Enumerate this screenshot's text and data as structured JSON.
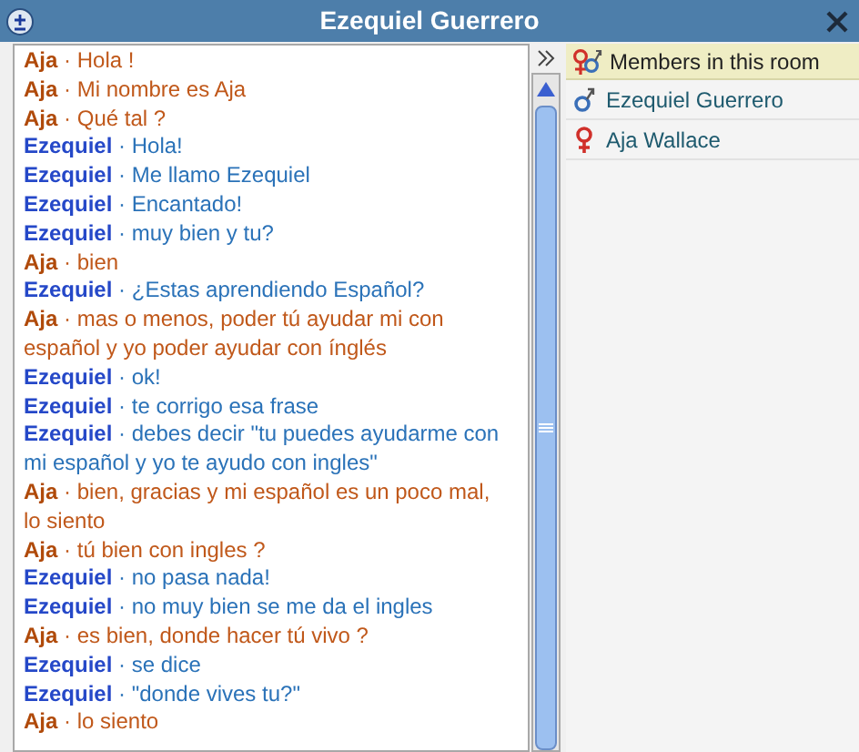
{
  "window": {
    "title": "Ezequiel Guerrero"
  },
  "messages": [
    {
      "sender": "Aja",
      "kind": "aja",
      "separator": "·",
      "text": "Hola !"
    },
    {
      "sender": "Aja",
      "kind": "aja",
      "separator": "·",
      "text": "Mi nombre es Aja"
    },
    {
      "sender": "Aja",
      "kind": "aja",
      "separator": "·",
      "text": "Qué tal ?"
    },
    {
      "sender": "Ezequiel",
      "kind": "ezequiel",
      "separator": "·",
      "text": "Hola!"
    },
    {
      "sender": "Ezequiel",
      "kind": "ezequiel",
      "separator": "·",
      "text": "Me llamo Ezequiel"
    },
    {
      "sender": "Ezequiel",
      "kind": "ezequiel",
      "separator": "·",
      "text": "Encantado!"
    },
    {
      "sender": "Ezequiel",
      "kind": "ezequiel",
      "separator": "·",
      "text": "muy bien y tu?"
    },
    {
      "sender": "Aja",
      "kind": "aja",
      "separator": "·",
      "text": "bien"
    },
    {
      "sender": "Ezequiel",
      "kind": "ezequiel",
      "separator": "·",
      "text": "¿Estas aprendiendo Español?"
    },
    {
      "sender": "Aja",
      "kind": "aja",
      "separator": "·",
      "text": "mas o menos, poder tú ayudar mi con español y yo poder ayudar con ínglés"
    },
    {
      "sender": "Ezequiel",
      "kind": "ezequiel",
      "separator": "·",
      "text": "ok!"
    },
    {
      "sender": "Ezequiel",
      "kind": "ezequiel",
      "separator": "·",
      "text": "te corrigo esa frase"
    },
    {
      "sender": "Ezequiel",
      "kind": "ezequiel",
      "separator": "·",
      "text": "debes decir \"tu puedes ayudarme con mi español y yo te ayudo con ingles\""
    },
    {
      "sender": "Aja",
      "kind": "aja",
      "separator": "·",
      "text": "bien, gracias y mi español es un poco mal, lo siento"
    },
    {
      "sender": "Aja",
      "kind": "aja",
      "separator": "·",
      "text": "tú bien con ingles ?"
    },
    {
      "sender": "Ezequiel",
      "kind": "ezequiel",
      "separator": "·",
      "text": "no pasa nada!"
    },
    {
      "sender": "Ezequiel",
      "kind": "ezequiel",
      "separator": "·",
      "text": "no muy bien se me da el ingles"
    },
    {
      "sender": "Aja",
      "kind": "aja",
      "separator": "·",
      "text": "es bien, donde hacer tú vivo ?"
    },
    {
      "sender": "Ezequiel",
      "kind": "ezequiel",
      "separator": "·",
      "text": "se dice"
    },
    {
      "sender": "Ezequiel",
      "kind": "ezequiel",
      "separator": "·",
      "text": "\"donde vives tu?\""
    },
    {
      "sender": "Aja",
      "kind": "aja",
      "separator": "·",
      "text": "lo siento"
    }
  ],
  "members": {
    "header": "Members in this room",
    "items": [
      {
        "name": "Ezequiel Guerrero",
        "kind": "male"
      },
      {
        "name": "Aja Wallace",
        "kind": "female"
      }
    ]
  }
}
